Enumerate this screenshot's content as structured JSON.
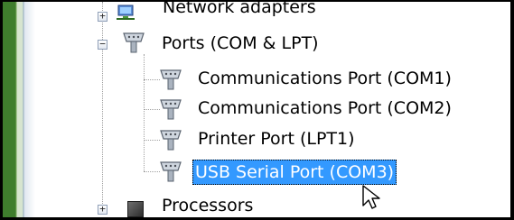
{
  "tree": {
    "items": [
      {
        "label": "Network adapters",
        "level": 1,
        "expander": "+"
      },
      {
        "label": "Ports (COM & LPT)",
        "level": 1,
        "expander": "−"
      },
      {
        "label": "Communications Port (COM1)",
        "level": 2
      },
      {
        "label": "Communications Port (COM2)",
        "level": 2
      },
      {
        "label": "Printer Port (LPT1)",
        "level": 2
      },
      {
        "label": "USB Serial Port (COM3)",
        "level": 2,
        "selected": true
      },
      {
        "label": "Processors",
        "level": 1,
        "expander": "+"
      }
    ]
  },
  "icons": {
    "network": "network-adapter-icon",
    "port": "port-connector-icon",
    "processor": "processor-chip-icon",
    "cursor": "mouse-pointer-icon"
  },
  "colors": {
    "selection": "#3399ff",
    "left_strip": "#3f7d2d"
  }
}
